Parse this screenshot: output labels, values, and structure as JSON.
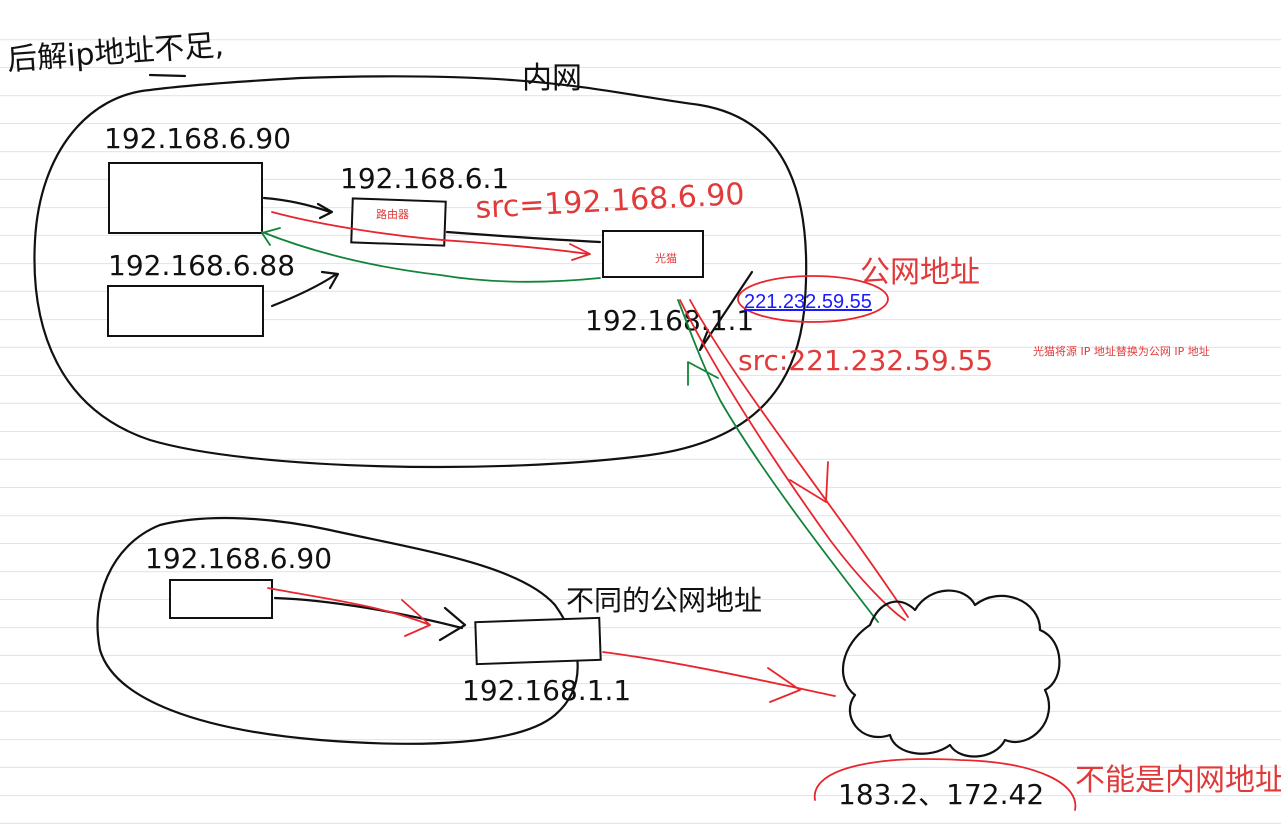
{
  "header_note": "后解ip地址不足,",
  "intranet_label": "内网",
  "hosts": {
    "pc1": "192.168.6.90",
    "pc2": "192.168.6.88",
    "router_ip": "192.168.6.1",
    "modem_ip": "192.168.1.1",
    "pc3": "192.168.6.90",
    "modem2_ip": "192.168.1.1"
  },
  "devices": {
    "router": "路由器",
    "modem": "光猫"
  },
  "src_before": "src=192.168.6.90",
  "public_label": "公网地址",
  "public_ip": "221.232.59.55",
  "src_after": "src:221.232.59.55",
  "nat_note": "光猫将源 IP 地址替换为公网 IP 地址",
  "second_note": "不同的公网地址",
  "bottom_ip": "183.2、172.42",
  "bottom_note": "不能是内网地址",
  "colors": {
    "red": "#e8262e",
    "green": "#11843a",
    "link": "#1a1aff",
    "ruled_line": "#d4e6f4"
  }
}
